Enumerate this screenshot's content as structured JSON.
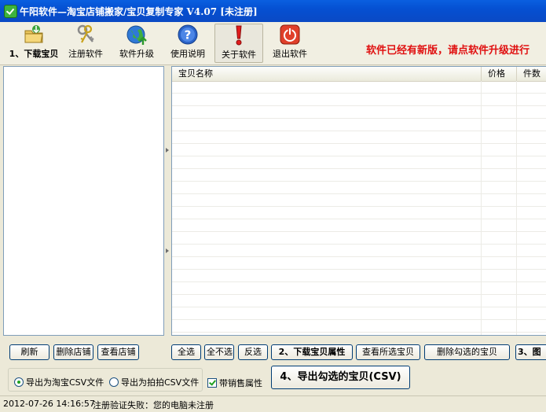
{
  "window": {
    "title": "午阳软件—淘宝店铺搬家/宝贝复制专家 V4.07 [未注册]"
  },
  "toolbar": {
    "items": [
      {
        "label": "1、下载宝贝",
        "icon": "folder-download-icon"
      },
      {
        "label": "注册软件",
        "icon": "keys-icon"
      },
      {
        "label": "软件升级",
        "icon": "globe-upgrade-icon"
      },
      {
        "label": "使用说明",
        "icon": "help-icon"
      },
      {
        "label": "关于软件",
        "icon": "exclamation-icon"
      },
      {
        "label": "退出软件",
        "icon": "power-icon"
      }
    ],
    "notice": "软件已经有新版，请点软件升级进行"
  },
  "grid": {
    "columns": [
      "宝贝名称",
      "价格",
      "件数"
    ],
    "rows": []
  },
  "left_buttons": {
    "refresh": "刷新",
    "delete_shop": "删除店铺",
    "view_shop": "查看店铺"
  },
  "right_buttons": {
    "select_all": "全选",
    "select_none": "全不选",
    "invert": "反选",
    "download_props": "2、下载宝贝属性",
    "view_selected": "查看所选宝贝",
    "delete_checked": "删除勾选的宝贝",
    "step3": "3、图"
  },
  "export": {
    "taobao_csv": "导出为淘宝CSV文件",
    "paipai_csv": "导出为拍拍CSV文件",
    "with_sales_attr": "带销售属性",
    "export_button": "4、导出勾选的宝贝(CSV)"
  },
  "status": {
    "datetime": "2012-07-26 14:16:57",
    "message": "注册验证失败：您的电脑未注册"
  },
  "colors": {
    "title_bar": "#0a5fe0",
    "notice": "#e01010",
    "accent_green": "#21a121"
  }
}
